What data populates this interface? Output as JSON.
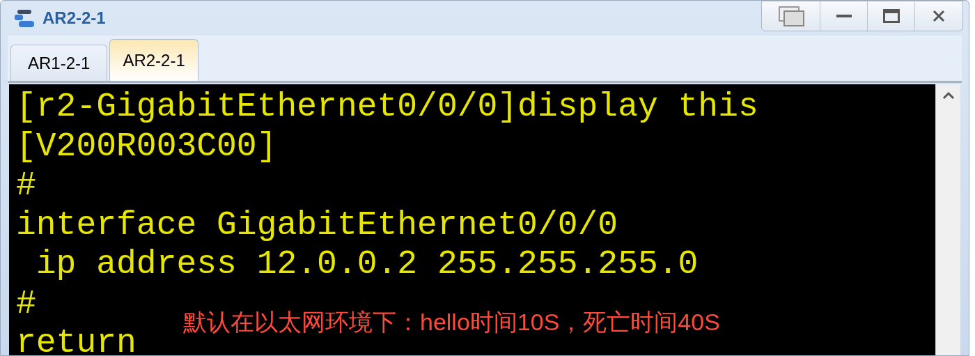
{
  "window": {
    "title": "AR2-2-1"
  },
  "tabs": [
    {
      "label": "AR1-2-1",
      "selected": false
    },
    {
      "label": "AR2-2-1",
      "selected": true
    }
  ],
  "terminal": {
    "lines": [
      "[r2-GigabitEthernet0/0/0]display this",
      "[V200R003C00]",
      "#",
      "interface GigabitEthernet0/0/0",
      " ip address 12.0.0.2 255.255.255.0",
      "#",
      "return"
    ]
  },
  "annotation": "默认在以太网环境下：hello时间10S，死亡时间40S"
}
